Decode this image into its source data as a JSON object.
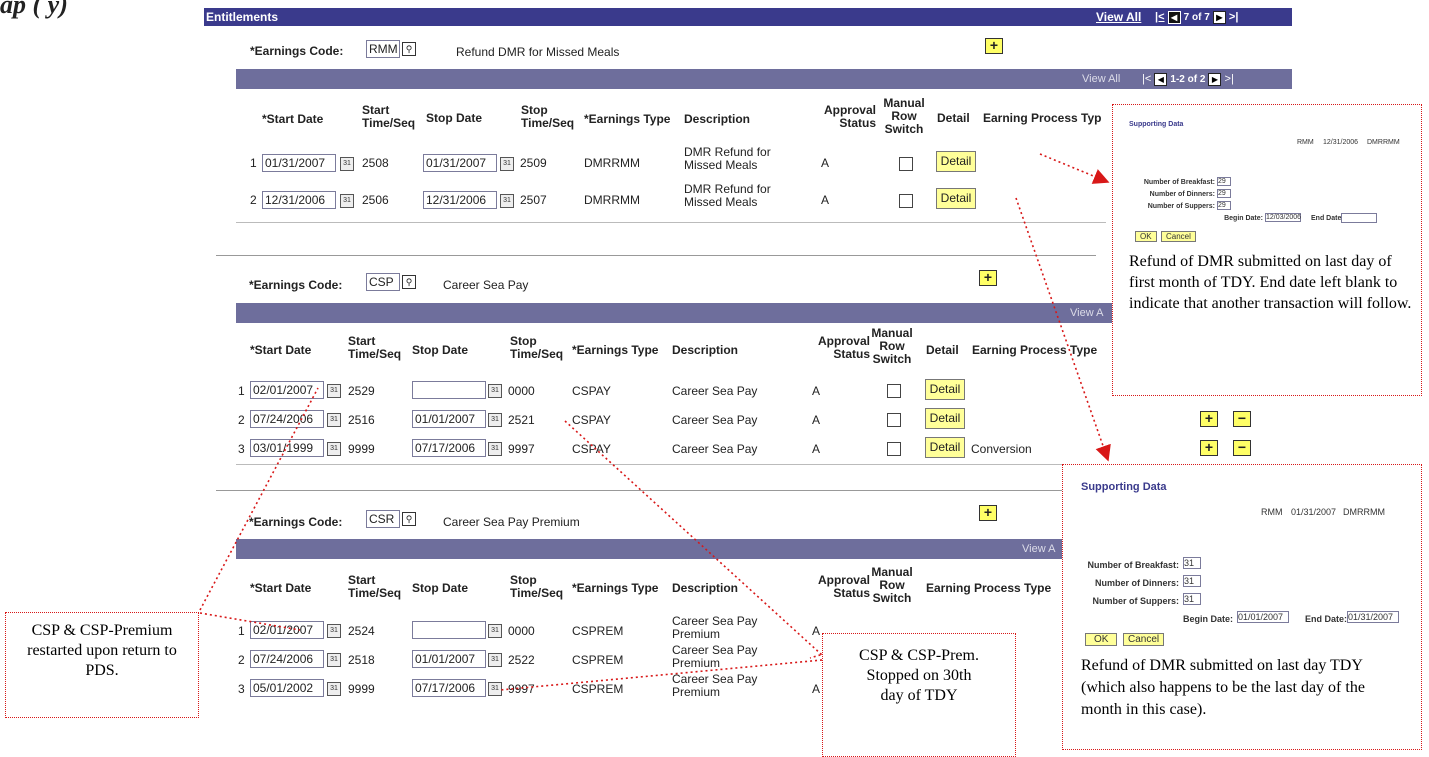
{
  "header_partial": "ap          (        y)",
  "titlebar": {
    "title": "Entitlements",
    "view_all": "View All",
    "pager": "7 of 7"
  },
  "columns": {
    "start_date": "*Start Date",
    "start_time": [
      "Start",
      "Time/Seq"
    ],
    "stop_date": "Stop Date",
    "stop_time": [
      "Stop",
      "Time/Seq"
    ],
    "earnings_type": "*Earnings Type",
    "description": "Description",
    "approval": [
      "Approval",
      "Status"
    ],
    "manual": [
      "Manual",
      "Row",
      "Switch"
    ],
    "detail": "Detail",
    "process_type": "Earning Process Type",
    "process_type_cut": "Earning Process Typ"
  },
  "sections": [
    {
      "code_label": "*Earnings Code:",
      "code": "RMM",
      "code_desc": "Refund DMR for Missed Meals",
      "grid_view_all": "View All",
      "grid_pager": "1-2 of 2",
      "rows": [
        {
          "num": "1",
          "start": "01/31/2007",
          "start_seq": "2508",
          "stop": "01/31/2007",
          "stop_seq": "2509",
          "type": "DMRRMM",
          "desc": [
            "DMR Refund for",
            "Missed Meals"
          ],
          "status": "A",
          "detail": "Detail",
          "process": ""
        },
        {
          "num": "2",
          "start": "12/31/2006",
          "start_seq": "2506",
          "stop": "12/31/2006",
          "stop_seq": "2507",
          "type": "DMRRMM",
          "desc": [
            "DMR Refund for",
            "Missed Meals"
          ],
          "status": "A",
          "detail": "Detail",
          "process": ""
        }
      ]
    },
    {
      "code_label": "*Earnings Code:",
      "code": "CSP",
      "code_desc": "Career Sea Pay",
      "grid_view_all": "View A",
      "rows": [
        {
          "num": "1",
          "start": "02/01/2007",
          "start_seq": "2529",
          "stop": "",
          "stop_seq": "0000",
          "type": "CSPAY",
          "desc": [
            "Career Sea Pay"
          ],
          "status": "A",
          "detail": "Detail",
          "process": ""
        },
        {
          "num": "2",
          "start": "07/24/2006",
          "start_seq": "2516",
          "stop": "01/01/2007",
          "stop_seq": "2521",
          "type": "CSPAY",
          "desc": [
            "Career Sea Pay"
          ],
          "status": "A",
          "detail": "Detail",
          "process": ""
        },
        {
          "num": "3",
          "start": "03/01/1999",
          "start_seq": "9999",
          "stop": "07/17/2006",
          "stop_seq": "9997",
          "type": "CSPAY",
          "desc": [
            "Career Sea Pay"
          ],
          "status": "A",
          "detail": "Detail",
          "process": "Conversion"
        }
      ]
    },
    {
      "code_label": "*Earnings Code:",
      "code": "CSR",
      "code_desc": "Career Sea Pay Premium",
      "grid_view_all": "View A",
      "rows": [
        {
          "num": "1",
          "start": "02/01/2007",
          "start_seq": "2524",
          "stop": "",
          "stop_seq": "0000",
          "type": "CSPREM",
          "desc": [
            "Career Sea Pay",
            "Premium"
          ],
          "status": "A"
        },
        {
          "num": "2",
          "start": "07/24/2006",
          "start_seq": "2518",
          "stop": "01/01/2007",
          "stop_seq": "2522",
          "type": "CSPREM",
          "desc": [
            "Career Sea Pay",
            "Premium"
          ],
          "status": "A"
        },
        {
          "num": "3",
          "start": "05/01/2002",
          "start_seq": "9999",
          "stop": "07/17/2006",
          "stop_seq": "9997",
          "type": "CSPREM",
          "desc": [
            "Career Sea Pay",
            "Premium"
          ],
          "status": "A"
        }
      ]
    }
  ],
  "callouts": {
    "top_right": {
      "title": "Supporting Data",
      "code": "RMM",
      "date": "12/31/2006",
      "type": "DMRRMM",
      "breakfast_label": "Number of Breakfast:",
      "breakfast": "29",
      "dinners_label": "Number of Dinners:",
      "dinners": "29",
      "suppers_label": "Number of Suppers:",
      "suppers": "29",
      "begin_label": "Begin Date:",
      "begin": "12/03/2006",
      "end_label": "End Date:",
      "end": "",
      "ok": "OK",
      "cancel": "Cancel",
      "note": "Refund of DMR submitted on last day of first month of TDY. End date left blank to indicate that another transaction will follow."
    },
    "bottom_right": {
      "title": "Supporting Data",
      "code": "RMM",
      "date": "01/31/2007",
      "type": "DMRRMM",
      "breakfast_label": "Number of Breakfast:",
      "breakfast": "31",
      "dinners_label": "Number of Dinners:",
      "dinners": "31",
      "suppers_label": "Number of Suppers:",
      "suppers": "31",
      "begin_label": "Begin Date:",
      "begin": "01/01/2007",
      "end_label": "End Date:",
      "end": "01/31/2007",
      "ok": "OK",
      "cancel": "Cancel",
      "note": "Refund of DMR submitted on last day TDY (which also happens to be the last day of the month in this case)."
    },
    "left": {
      "note": "CSP & CSP-Premium restarted upon return to PDS."
    },
    "middle": {
      "note": "CSP & CSP-Prem. Stopped on 30th day of TDY"
    }
  },
  "colors": {
    "title_bar": "#3a3a8c",
    "grid_bar": "#6e6e9c",
    "button_yellow": "#ffff99",
    "annotation_red": "#d81818"
  },
  "icons": [
    "search-icon",
    "calendar-icon",
    "add-row-icon",
    "delete-row-icon",
    "first-page-icon",
    "previous-page-icon",
    "next-page-icon",
    "last-page-icon"
  ]
}
